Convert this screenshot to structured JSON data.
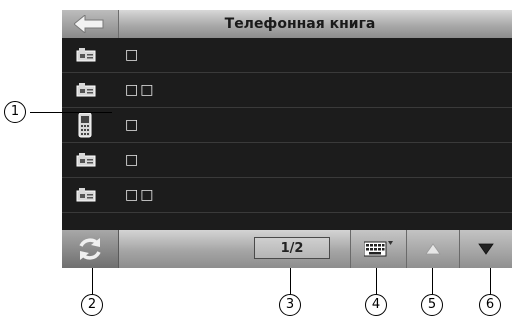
{
  "titlebar": {
    "title": "Телефонная книга"
  },
  "contacts": [
    {
      "icon": "card-icon",
      "name": "□"
    },
    {
      "icon": "card-icon",
      "name": "□□"
    },
    {
      "icon": "phone-icon",
      "name": "□"
    },
    {
      "icon": "card-icon",
      "name": "□"
    },
    {
      "icon": "card-icon",
      "name": "□□"
    }
  ],
  "bottombar": {
    "page_indicator": "1/2"
  },
  "callouts": {
    "c1": "1",
    "c2": "2",
    "c3": "3",
    "c4": "4",
    "c5": "5",
    "c6": "6"
  }
}
